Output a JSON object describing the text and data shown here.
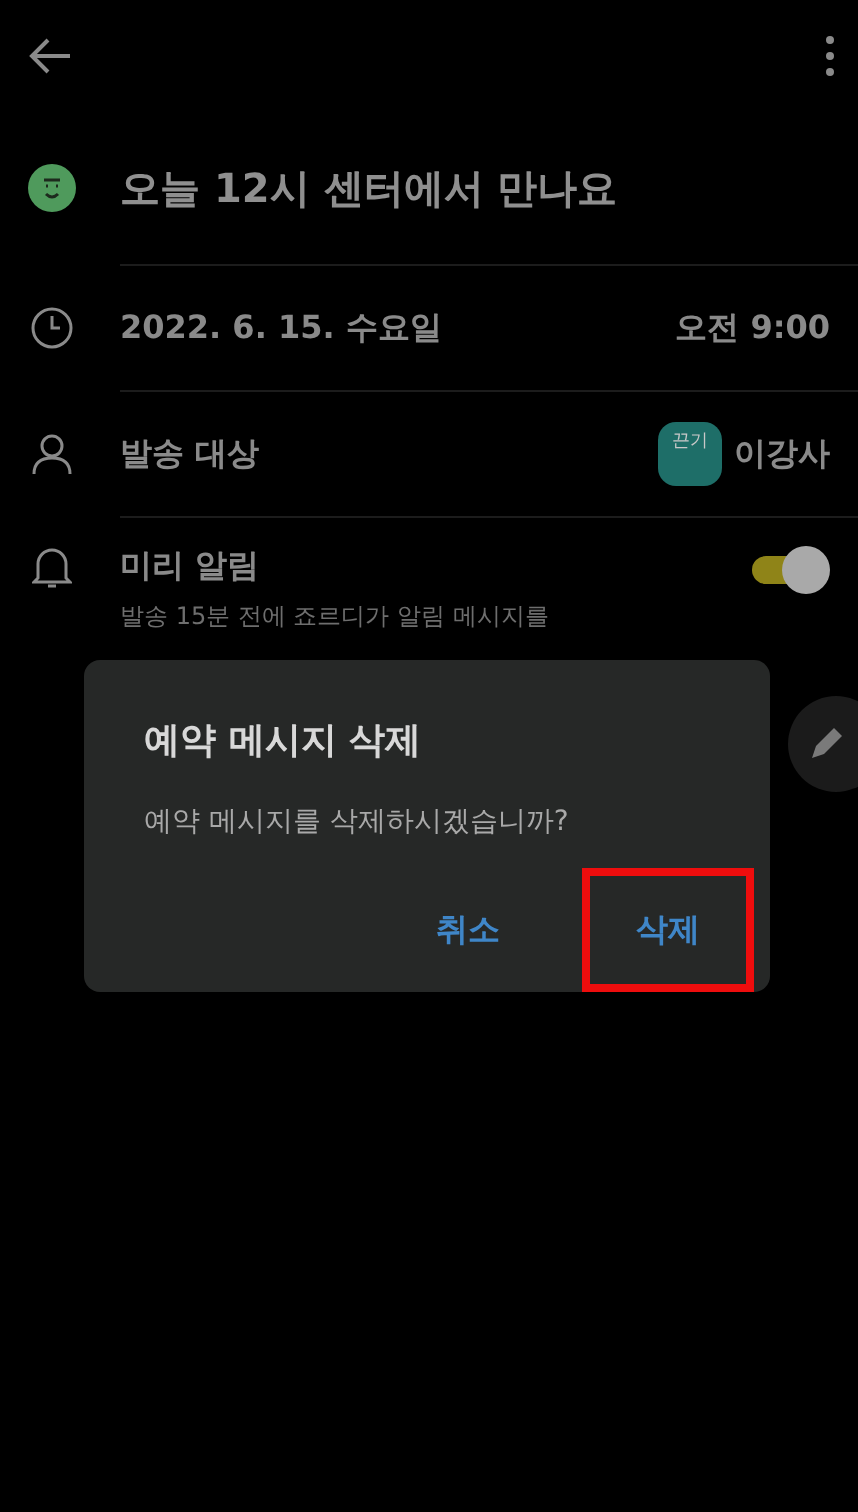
{
  "title": "오늘 12시 센터에서 만나요",
  "date_row": {
    "date": "2022. 6. 15. 수요일",
    "time": "오전 9:00"
  },
  "target_row": {
    "label": "발송 대상",
    "badge": "끈기",
    "name": "이강사"
  },
  "reminder_row": {
    "label": "미리 알림",
    "description": "발송 15분 전에 죠르디가 알림 메시지를",
    "on": true
  },
  "dialog": {
    "title": "예약 메시지 삭제",
    "message": "예약 메시지를 삭제하시겠습니까?",
    "buttons": [
      {
        "label": "취소",
        "highlighted": false
      },
      {
        "label": "삭제",
        "highlighted": true
      }
    ]
  }
}
